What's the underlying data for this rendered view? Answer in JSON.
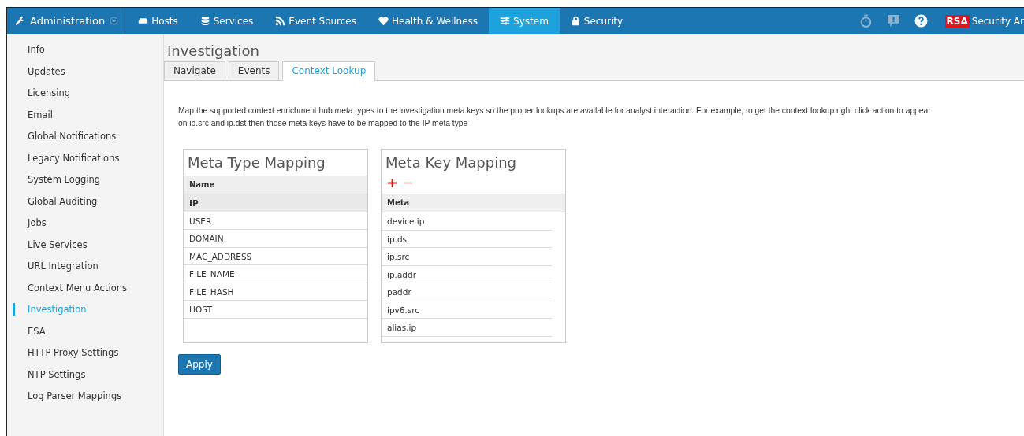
{
  "nav": {
    "items": [
      {
        "label": "Administration",
        "kind": "menu",
        "selected": false
      },
      {
        "label": "Hosts",
        "kind": "hosts",
        "selected": false
      },
      {
        "label": "Services",
        "kind": "services",
        "selected": false
      },
      {
        "label": "Event Sources",
        "kind": "sources",
        "selected": false
      },
      {
        "label": "Health & Wellness",
        "kind": "health",
        "selected": false
      },
      {
        "label": "System",
        "kind": "system",
        "selected": true
      },
      {
        "label": "Security",
        "kind": "security",
        "selected": false
      }
    ],
    "logo": "RSA",
    "product": "Security Ar"
  },
  "sidebar": {
    "items": [
      {
        "label": "Info",
        "selected": false
      },
      {
        "label": "Updates",
        "selected": false
      },
      {
        "label": "Licensing",
        "selected": false
      },
      {
        "label": "Email",
        "selected": false
      },
      {
        "label": "Global Notifications",
        "selected": false
      },
      {
        "label": "Legacy Notifications",
        "selected": false
      },
      {
        "label": "System Logging",
        "selected": false
      },
      {
        "label": "Global Auditing",
        "selected": false
      },
      {
        "label": "Jobs",
        "selected": false
      },
      {
        "label": "Live Services",
        "selected": false
      },
      {
        "label": "URL Integration",
        "selected": false
      },
      {
        "label": "Context Menu Actions",
        "selected": false
      },
      {
        "label": "Investigation",
        "selected": true
      },
      {
        "label": "ESA",
        "selected": false
      },
      {
        "label": "HTTP Proxy Settings",
        "selected": false
      },
      {
        "label": "NTP Settings",
        "selected": false
      },
      {
        "label": "Log Parser Mappings",
        "selected": false
      }
    ]
  },
  "page": {
    "title": "Investigation",
    "tabs": [
      {
        "label": "Navigate",
        "selected": false
      },
      {
        "label": "Events",
        "selected": false
      },
      {
        "label": "Context Lookup",
        "selected": true
      }
    ],
    "description": [
      "Map the supported context enrichment hub meta types to the investigation meta keys so the proper lookups are available for analyst interaction. For example, to get the context lookup right click action to appear",
      "on ip.src and ip.dst then those meta keys have to be mapped to the IP meta type"
    ],
    "meta_type_mapping": {
      "title": "Meta Type Mapping",
      "column": "Name",
      "rows": [
        {
          "name": "IP",
          "selected": true
        },
        {
          "name": "USER",
          "selected": false
        },
        {
          "name": "DOMAIN",
          "selected": false
        },
        {
          "name": "MAC_ADDRESS",
          "selected": false
        },
        {
          "name": "FILE_NAME",
          "selected": false
        },
        {
          "name": "FILE_HASH",
          "selected": false
        },
        {
          "name": "HOST",
          "selected": false
        }
      ]
    },
    "meta_key_mapping": {
      "title": "Meta Key Mapping",
      "toolbar": [
        {
          "kind": "add",
          "disabled": false
        },
        {
          "kind": "remove",
          "disabled": true
        }
      ],
      "column": "Meta",
      "rows": [
        "device.ip",
        "ip.dst",
        "ip.src",
        "ip.addr",
        "paddr",
        "ipv6.src",
        "alias.ip"
      ]
    },
    "apply_button": "Apply"
  }
}
